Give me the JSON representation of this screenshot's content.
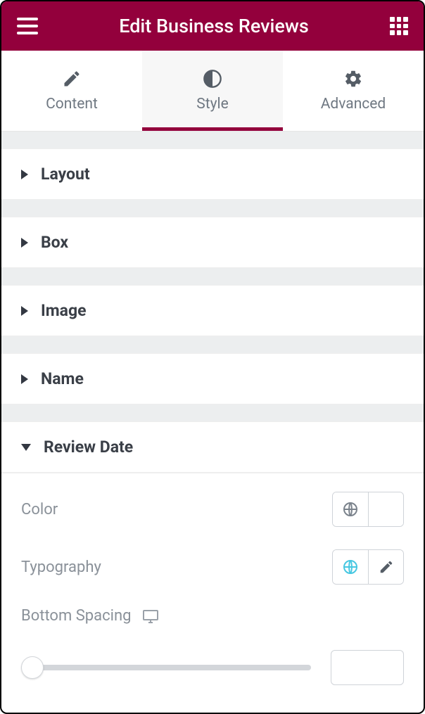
{
  "header": {
    "title": "Edit Business Reviews"
  },
  "tabs": {
    "content": "Content",
    "style": "Style",
    "advanced": "Advanced",
    "active": "style"
  },
  "sections": {
    "layout": "Layout",
    "box": "Box",
    "image": "Image",
    "name": "Name",
    "review_date": "Review Date"
  },
  "controls": {
    "color": {
      "label": "Color",
      "value": "#7f1712"
    },
    "typography": {
      "label": "Typography"
    },
    "bottom_spacing": {
      "label": "Bottom Spacing",
      "value": ""
    }
  }
}
